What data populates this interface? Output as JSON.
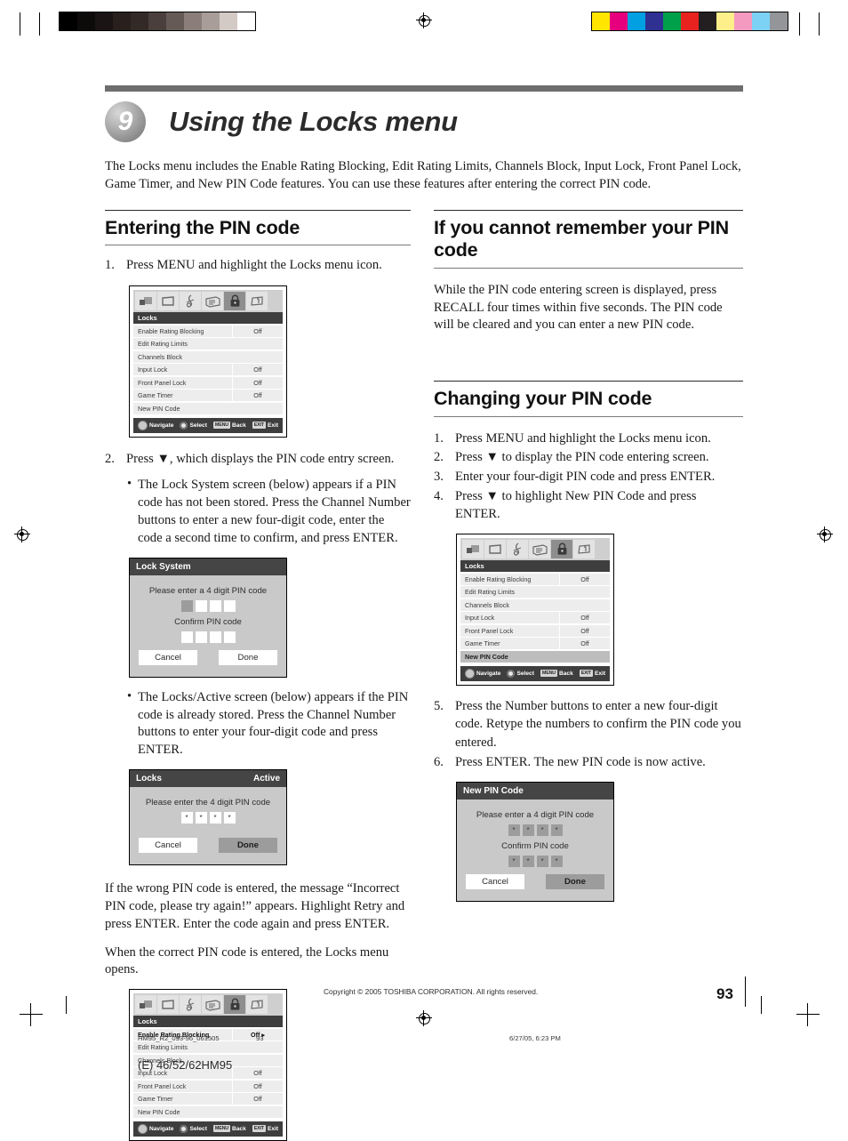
{
  "printer": {
    "grayscale_bars": [
      "#000000",
      "#0d0a0a",
      "#1a1414",
      "#29201e",
      "#332a28",
      "#4a3f3d",
      "#665a57",
      "#8a7d7a",
      "#a89d99",
      "#d3c9c5",
      "#ffffff"
    ],
    "color_bars": [
      "#ffe500",
      "#e6007e",
      "#00a0e2",
      "#2e3191",
      "#00a04a",
      "#e8221f",
      "#231f20",
      "#ffef8a",
      "#f49ac1",
      "#7cd2f5",
      "#939598"
    ]
  },
  "header": {
    "chapter_number": "9",
    "chapter_title": "Using the Locks menu",
    "intro": "The Locks menu includes the Enable Rating Blocking, Edit Rating Limits, Channels Block, Input Lock, Front Panel Lock, Game Timer, and New PIN Code features. You can use these features after entering the correct PIN code."
  },
  "left_column": {
    "section_title": "Entering the PIN code",
    "step1": {
      "num": "1.",
      "text": "Press MENU and highlight the Locks menu icon."
    },
    "locks_menu_1": {
      "title": "Locks",
      "status": "",
      "icons": [
        "picture-icon",
        "screen-icon",
        "audio-icon",
        "setup-icon",
        "lock-icon",
        "info-icon"
      ],
      "active_icon_index": 4,
      "rows": [
        {
          "label": "Enable Rating Blocking",
          "value": "Off",
          "state": "normal"
        },
        {
          "label": "Edit Rating Limits",
          "value": "",
          "state": "normal"
        },
        {
          "label": "Channels Block",
          "value": "",
          "state": "normal"
        },
        {
          "label": "Input Lock",
          "value": "Off",
          "state": "normal"
        },
        {
          "label": "Front Panel Lock",
          "value": "Off",
          "state": "normal"
        },
        {
          "label": "Game Timer",
          "value": "Off",
          "state": "normal"
        },
        {
          "label": "New PIN Code",
          "value": "",
          "state": "normal"
        }
      ],
      "footer": {
        "navigate": "Navigate",
        "select": "Select",
        "back": "Back",
        "back_key": "MENU",
        "exit": "Exit",
        "exit_key": "EXIT"
      }
    },
    "step2": {
      "num": "2.",
      "text": "Press ▼, which displays the PIN code entry screen."
    },
    "bullet1": "The Lock System screen (below) appears if a PIN code has not been stored. Press the Channel Number buttons to enter a new four-digit code, enter the code a second time to confirm, and press ENTER.",
    "lock_system_dialog": {
      "title": "Lock System",
      "prompt1": "Please enter a 4 digit PIN code",
      "prompt2": "Confirm PIN code",
      "pin1": [
        "filled",
        "empty",
        "empty",
        "empty"
      ],
      "pin2": [
        "empty",
        "empty",
        "empty",
        "empty"
      ],
      "cancel": "Cancel",
      "done": "Done",
      "done_highlighted": false
    },
    "bullet2": "The Locks/Active screen (below) appears if the PIN code is already stored. Press the Channel Number buttons to enter your four-digit code and press ENTER.",
    "locks_active_dialog": {
      "title": "Locks",
      "status": "Active",
      "prompt1": "Please enter the 4 digit PIN code",
      "pin1": [
        "*",
        "*",
        "*",
        "*"
      ],
      "cancel": "Cancel",
      "done": "Done",
      "done_highlighted": true
    },
    "para1": "If the wrong PIN code is entered, the message “Incorrect PIN code, please try again!” appears. Highlight Retry and press ENTER. Enter the code again and press ENTER.",
    "para2": "When the correct PIN code is entered, the Locks menu opens.",
    "locks_menu_2": {
      "title": "Locks",
      "icons": [
        "picture-icon",
        "screen-icon",
        "audio-icon",
        "setup-icon",
        "lock-icon",
        "info-icon"
      ],
      "active_icon_index": 4,
      "rows": [
        {
          "label": "Enable Rating Blocking",
          "value": "Off",
          "state": "bold",
          "arrow": "▸"
        },
        {
          "label": "Edit Rating Limits",
          "value": "",
          "state": "normal"
        },
        {
          "label": "Channels Block",
          "value": "",
          "state": "normal"
        },
        {
          "label": "Input Lock",
          "value": "Off",
          "state": "normal"
        },
        {
          "label": "Front Panel Lock",
          "value": "Off",
          "state": "normal"
        },
        {
          "label": "Game Timer",
          "value": "Off",
          "state": "normal"
        },
        {
          "label": "New PIN Code",
          "value": "",
          "state": "normal"
        }
      ],
      "footer": {
        "navigate": "Navigate",
        "select": "Select",
        "back": "Back",
        "back_key": "MENU",
        "exit": "Exit",
        "exit_key": "EXIT"
      }
    }
  },
  "right_column": {
    "section1_title": "If you cannot remember your PIN code",
    "section1_body": "While the PIN code entering screen is displayed, press RECALL four times within five seconds. The PIN code will be cleared and you can enter a new PIN code.",
    "section2_title": "Changing your PIN code",
    "steps": [
      {
        "num": "1.",
        "text": "Press MENU and highlight the Locks menu icon."
      },
      {
        "num": "2.",
        "text": "Press ▼ to display the PIN code entering screen."
      },
      {
        "num": "3.",
        "text": "Enter your four-digit PIN code and press ENTER."
      },
      {
        "num": "4.",
        "text": "Press ▼ to highlight New PIN Code and press ENTER."
      }
    ],
    "locks_menu_3": {
      "title": "Locks",
      "icons": [
        "picture-icon",
        "screen-icon",
        "audio-icon",
        "setup-icon",
        "lock-icon",
        "info-icon"
      ],
      "active_icon_index": 4,
      "rows": [
        {
          "label": "Enable Rating Blocking",
          "value": "Off",
          "state": "normal"
        },
        {
          "label": "Edit Rating Limits",
          "value": "",
          "state": "normal"
        },
        {
          "label": "Channels Block",
          "value": "",
          "state": "normal"
        },
        {
          "label": "Input Lock",
          "value": "Off",
          "state": "normal"
        },
        {
          "label": "Front Panel Lock",
          "value": "Off",
          "state": "normal"
        },
        {
          "label": "Game Timer",
          "value": "Off",
          "state": "normal"
        },
        {
          "label": "New PIN Code",
          "value": "",
          "state": "selected"
        }
      ],
      "footer": {
        "navigate": "Navigate",
        "select": "Select",
        "back": "Back",
        "back_key": "MENU",
        "exit": "Exit",
        "exit_key": "EXIT"
      }
    },
    "steps2": [
      {
        "num": "5.",
        "text": "Press the Number buttons to enter a new four-digit code. Retype the numbers to confirm the PIN code you entered."
      },
      {
        "num": "6.",
        "text": "Press ENTER. The new PIN code is now active."
      }
    ],
    "new_pin_dialog": {
      "title": "New PIN Code",
      "prompt1": "Please enter a 4 digit PIN code",
      "prompt2": "Confirm PIN code",
      "pin1": [
        "*",
        "*",
        "*",
        "*"
      ],
      "pin2": [
        "*",
        "*",
        "*",
        "*"
      ],
      "cancel": "Cancel",
      "done": "Done",
      "done_highlighted": true
    }
  },
  "footer": {
    "copyright": "Copyright © 2005 TOSHIBA CORPORATION. All rights reserved.",
    "page_number": "93",
    "file_name": "HM95_R2_093-96_061505",
    "foot_page": "93",
    "timestamp": "6/27/05, 6:23 PM",
    "model_line": "(E) 46/52/62HM95"
  }
}
